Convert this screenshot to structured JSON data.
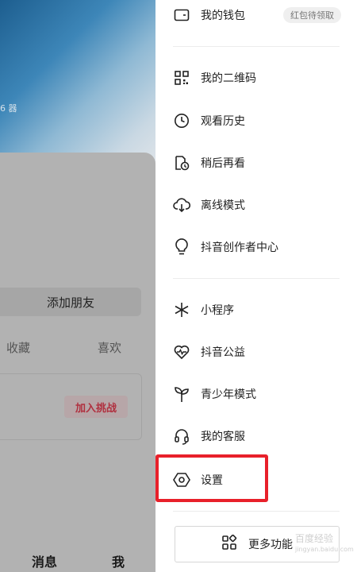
{
  "profile": {
    "cover_text": "6 器",
    "add_friend_label": "添加朋友",
    "tabs": [
      "收藏",
      "喜欢"
    ],
    "challenge_label": "加入挑战",
    "bottom_nav": [
      "消息",
      "我"
    ]
  },
  "drawer": {
    "wallet": {
      "label": "我的钱包",
      "badge": "红包待领取",
      "icon": "wallet-icon"
    },
    "group1": [
      {
        "label": "我的二维码",
        "icon": "qr-code-icon"
      },
      {
        "label": "观看历史",
        "icon": "clock-icon"
      },
      {
        "label": "稍后再看",
        "icon": "watch-later-icon"
      },
      {
        "label": "离线模式",
        "icon": "cloud-download-icon"
      },
      {
        "label": "抖音创作者中心",
        "icon": "lightbulb-icon"
      }
    ],
    "group2": [
      {
        "label": "小程序",
        "icon": "mini-program-icon"
      },
      {
        "label": "抖音公益",
        "icon": "charity-heart-icon"
      },
      {
        "label": "青少年模式",
        "icon": "sprout-icon"
      },
      {
        "label": "我的客服",
        "icon": "headset-icon"
      },
      {
        "label": "设置",
        "icon": "hexagon-settings-icon"
      }
    ],
    "more_label": "更多功能",
    "watermark": {
      "main": "百度经验",
      "sub": "jingyan.baidu.com"
    }
  },
  "colors": {
    "highlight": "#e8202a",
    "challenge_text": "#b0303f"
  }
}
